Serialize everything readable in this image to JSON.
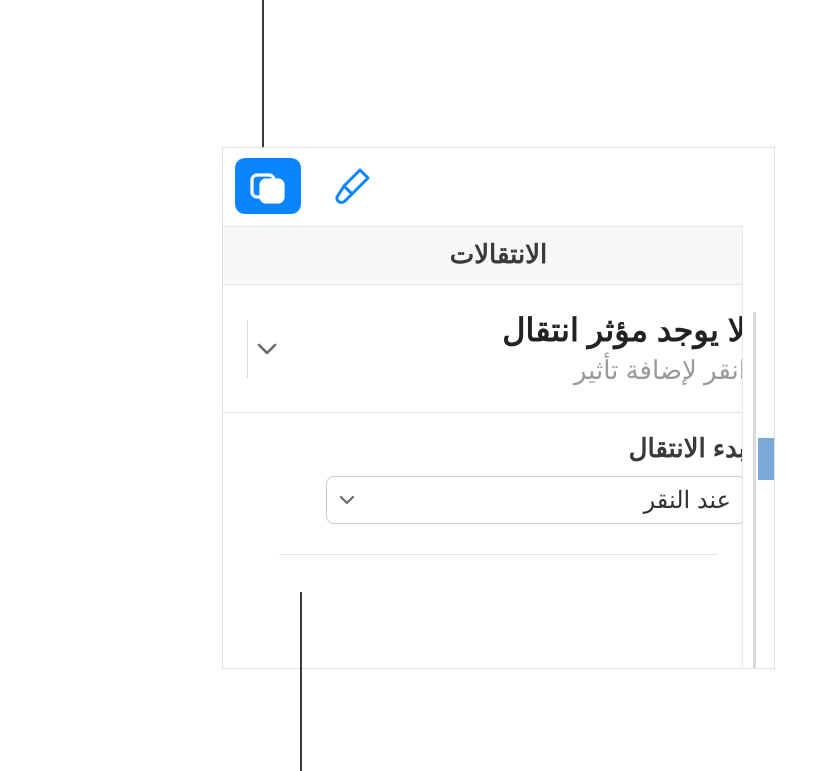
{
  "colors": {
    "accent": "#0a84ff",
    "iconInactive": "#0a84ff",
    "textPrimary": "#222222",
    "textSecondary": "#9a9a9a"
  },
  "icons": {
    "animate": "animate-icon",
    "format": "format-brush-icon"
  },
  "section": {
    "title": "الانتقالات"
  },
  "effect": {
    "title": "لا يوجد مؤثر انتقال",
    "subtitle": "انقر لإضافة تأثير"
  },
  "start": {
    "label": "بدء الانتقال",
    "selected": "عند النقر"
  }
}
